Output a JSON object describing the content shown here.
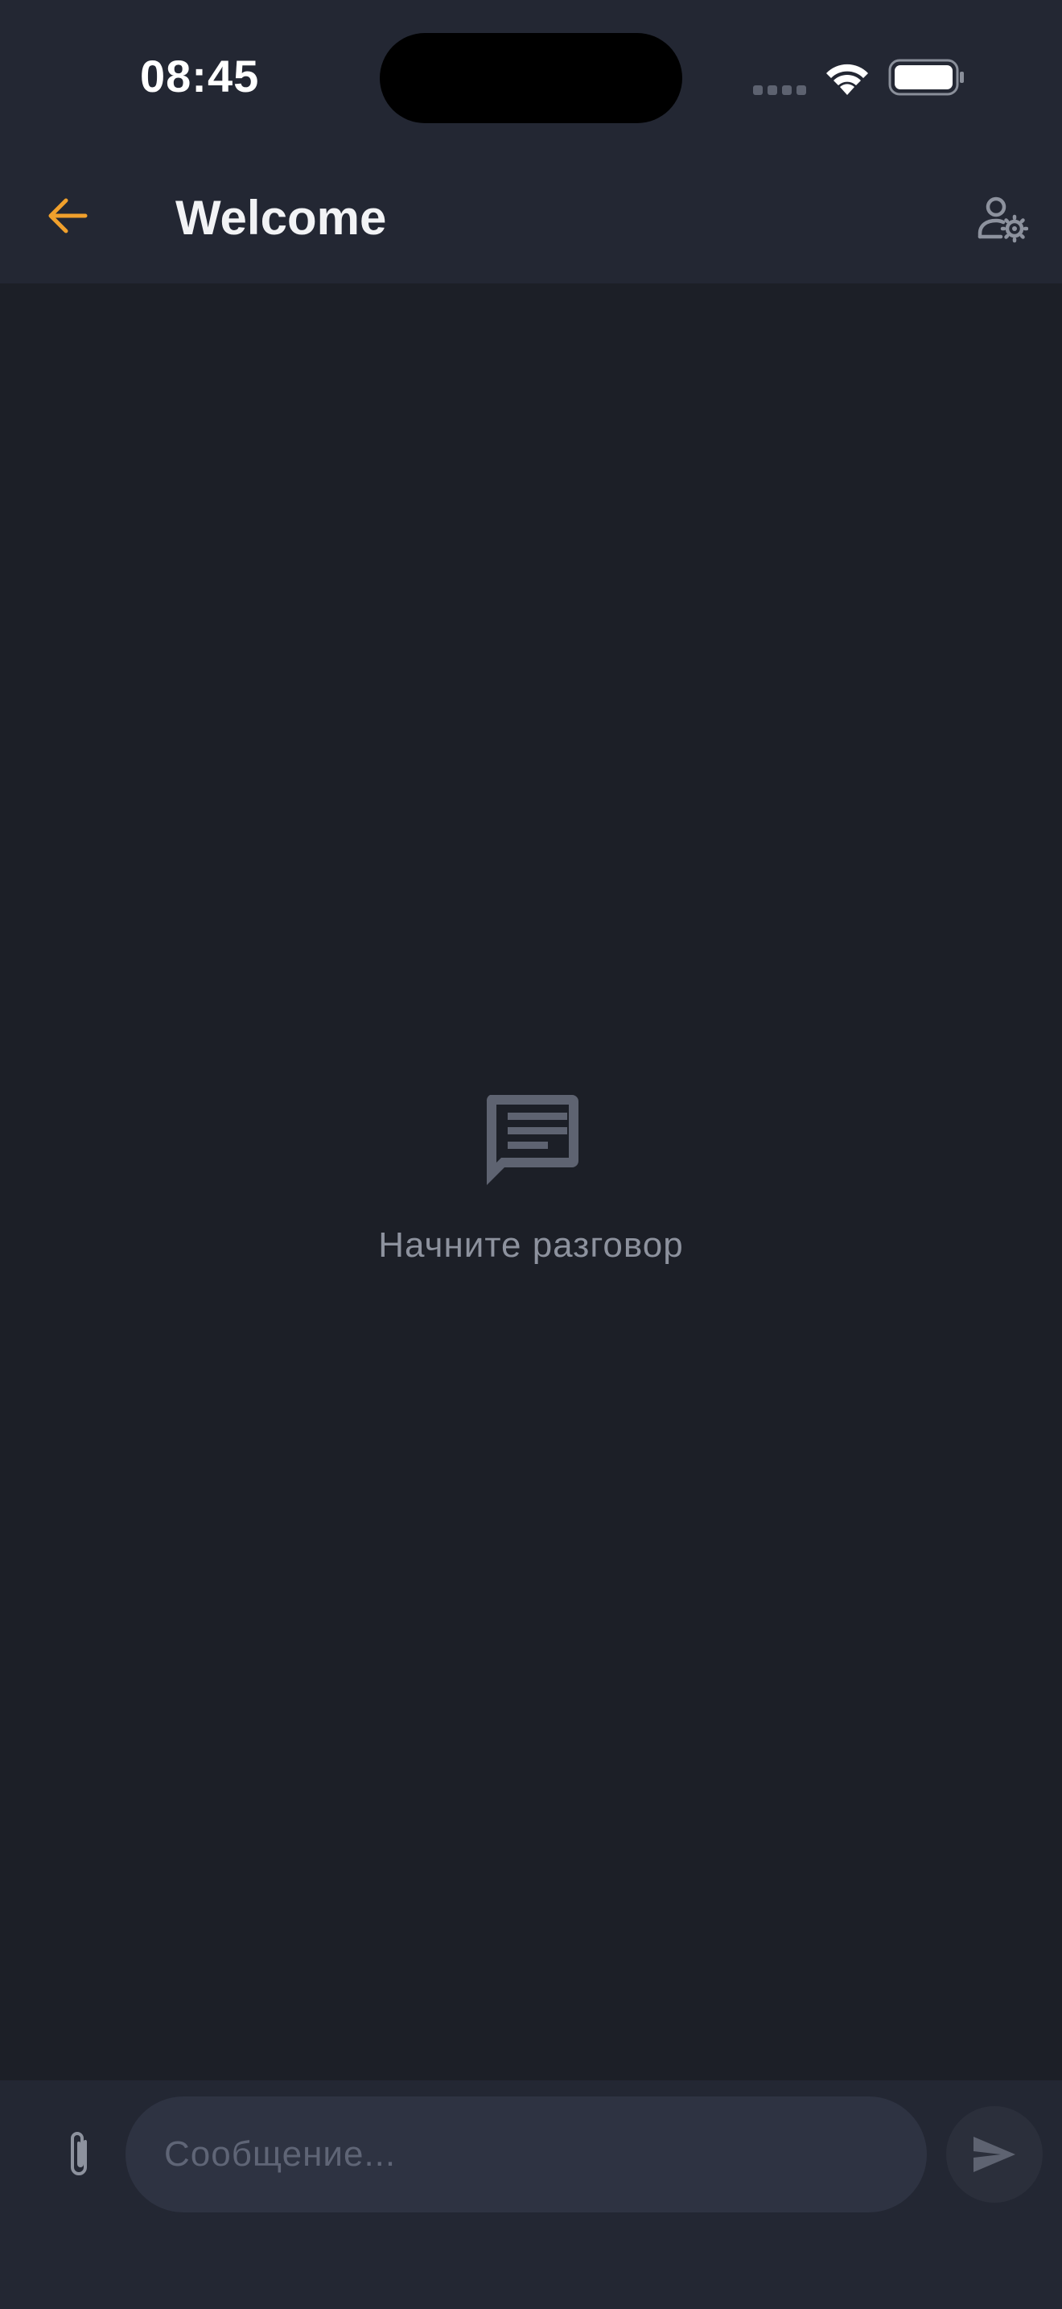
{
  "status_bar": {
    "time": "08:45"
  },
  "header": {
    "title": "Welcome",
    "back_icon": "arrow-left-icon",
    "settings_icon": "user-settings-icon"
  },
  "empty_state": {
    "icon": "chat-message-icon",
    "text": "Начните разговор"
  },
  "composer": {
    "placeholder": "Сообщение...",
    "value": "",
    "attach_icon": "paperclip-icon",
    "send_icon": "send-icon"
  },
  "colors": {
    "accent": "#f0a02c",
    "background": "#1c1f27",
    "bar": "#232733",
    "input": "#2e3342",
    "muted": "#8d929e"
  }
}
